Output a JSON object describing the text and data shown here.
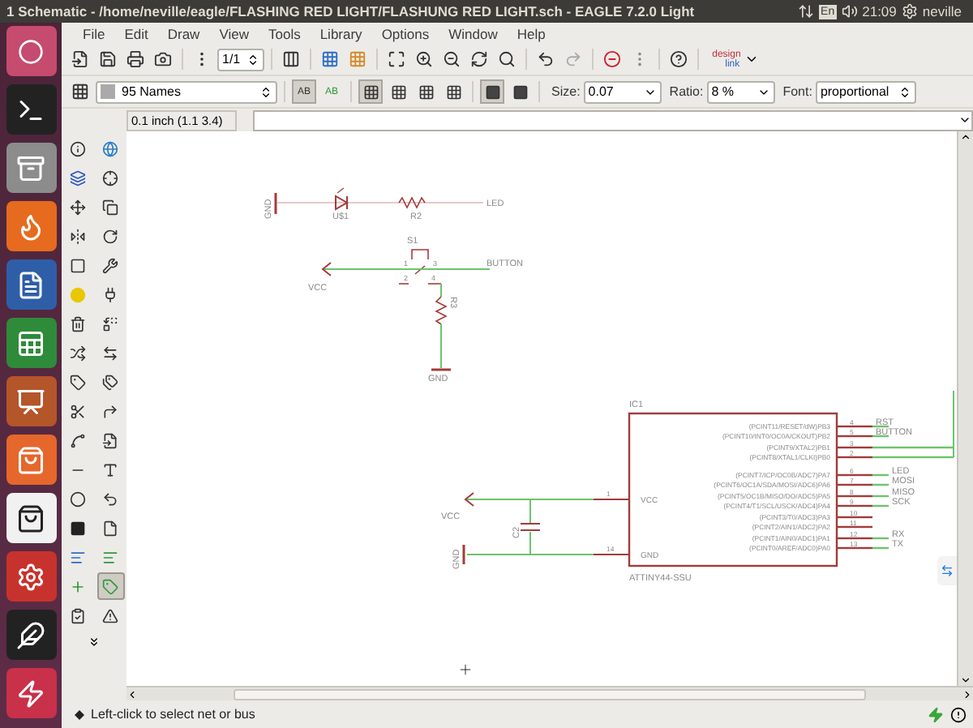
{
  "top_bar": {
    "title": "1 Schematic - /home/neville/eagle/FLASHING RED LIGHT/FLASHUNG RED LIGHT.sch - EAGLE 7.2.0 Light",
    "keyboard_layout": "En",
    "clock": "21:09",
    "user": "neville"
  },
  "menu": [
    "File",
    "Edit",
    "Draw",
    "View",
    "Tools",
    "Library",
    "Options",
    "Window",
    "Help"
  ],
  "toolbar": {
    "sheet": "1/1",
    "logo_top": "design",
    "logo_bottom": "link"
  },
  "param_bar": {
    "layer": "95 Names",
    "text_buttons": [
      {
        "label": "AB",
        "selected": true
      },
      {
        "label": "AB",
        "selected": false
      }
    ],
    "fill_buttons": [
      {
        "selected": true
      },
      {
        "selected": false
      },
      {
        "selected": false
      },
      {
        "selected": false
      }
    ],
    "view_buttons": [
      {
        "selected": true
      },
      {
        "selected": false
      }
    ],
    "size_label": "Size:",
    "size": "0.07",
    "ratio_label": "Ratio:",
    "ratio": "8 %",
    "font_label": "Font:",
    "font": "proportional"
  },
  "command_bar": {
    "coordinates": "0.1 inch (1.1 3.4)"
  },
  "palette": [
    {
      "kind": "info",
      "selected": false
    },
    {
      "kind": "show",
      "selected": false
    },
    {
      "kind": "layers",
      "selected": false
    },
    {
      "kind": "mark",
      "selected": false
    },
    {
      "kind": "move",
      "selected": false
    },
    {
      "kind": "copy",
      "selected": false
    },
    {
      "kind": "mirror",
      "selected": false
    },
    {
      "kind": "rotate",
      "selected": false
    },
    {
      "kind": "group",
      "selected": false
    },
    {
      "kind": "change",
      "selected": false
    },
    {
      "kind": "paint",
      "selected": false
    },
    {
      "kind": "add",
      "selected": false
    },
    {
      "kind": "delete",
      "selected": false
    },
    {
      "kind": "replace",
      "selected": false
    },
    {
      "kind": "gateswap",
      "selected": false
    },
    {
      "kind": "pinswap",
      "selected": false
    },
    {
      "kind": "name",
      "selected": false
    },
    {
      "kind": "value",
      "selected": false
    },
    {
      "kind": "smash",
      "selected": false
    },
    {
      "kind": "miter",
      "selected": false
    },
    {
      "kind": "split",
      "selected": false
    },
    {
      "kind": "invoke",
      "selected": false
    },
    {
      "kind": "wire",
      "selected": false
    },
    {
      "kind": "text",
      "selected": false
    },
    {
      "kind": "circle",
      "selected": false
    },
    {
      "kind": "arc",
      "selected": false
    },
    {
      "kind": "rect",
      "selected": false
    },
    {
      "kind": "polygon",
      "selected": false
    },
    {
      "kind": "bus",
      "selected": false
    },
    {
      "kind": "net",
      "selected": false
    },
    {
      "kind": "junction",
      "selected": false
    },
    {
      "kind": "label",
      "selected": true
    },
    {
      "kind": "erc",
      "selected": false
    },
    {
      "kind": "errors",
      "selected": false
    }
  ],
  "schematic": {
    "led_circuit": {
      "ground": "GND",
      "led": "U$1",
      "resistor": "R2",
      "net": "LED"
    },
    "switch_circuit": {
      "switch": "S1",
      "pins": [
        "1",
        "2",
        "3",
        "4"
      ],
      "supply": "VCC",
      "net": "BUTTON",
      "resistor": "R3",
      "ground": "GND"
    },
    "chip": {
      "name": "IC1",
      "part": "ATTINY44-SSU",
      "power_pins": [
        {
          "number": "1",
          "name": "VCC"
        },
        {
          "number": "14",
          "name": "GND"
        }
      ],
      "pins": [
        {
          "number": "4",
          "name": "(PCINT11/RESET/dW)PB3",
          "net": "RST",
          "wired": true
        },
        {
          "number": "5",
          "name": "(PCINT10/INT0/OC0A/CKOUT)PB2",
          "net": "BUTTON",
          "wired": true
        },
        {
          "number": "3",
          "name": "(PCINT9/XTAL2)PB1",
          "wired": true
        },
        {
          "number": "2",
          "name": "(PCINT8/XTAL1/CLKI)PB0",
          "wired": true
        },
        {
          "number": "6",
          "name": "(PCINT7/ICP/OC0B/ADC7)PA7",
          "net": "LED",
          "wired": true
        },
        {
          "number": "7",
          "name": "(PCINT6/OC1A/SDA/MOSI/ADC6)PA6",
          "net": "MOSI",
          "wired": true
        },
        {
          "number": "8",
          "name": "(PCINT5/OC1B/MISO/DO/ADC5)PA5",
          "net": "MISO",
          "wired": true
        },
        {
          "number": "9",
          "name": "(PCINT4/T1/SCL/USCK/ADC4)PA4",
          "net": "SCK",
          "wired": true
        },
        {
          "number": "10",
          "name": "(PCINT3/T0/ADC3)PA3",
          "wired": false
        },
        {
          "number": "11",
          "name": "(PCINT2/AIN1/ADC2)PA2",
          "wired": false
        },
        {
          "number": "12",
          "name": "(PCINT1/AIN0/ADC1)PA1",
          "net": "RX",
          "wired": true
        },
        {
          "number": "13",
          "name": "(PCINT0/AREF/ADC0)PA0",
          "net": "TX",
          "wired": true
        }
      ]
    },
    "decoupling": {
      "supply": "VCC",
      "capacitor": "C2",
      "ground": "GND"
    }
  },
  "status_bar": {
    "message": "Left-click to select net or bus"
  }
}
